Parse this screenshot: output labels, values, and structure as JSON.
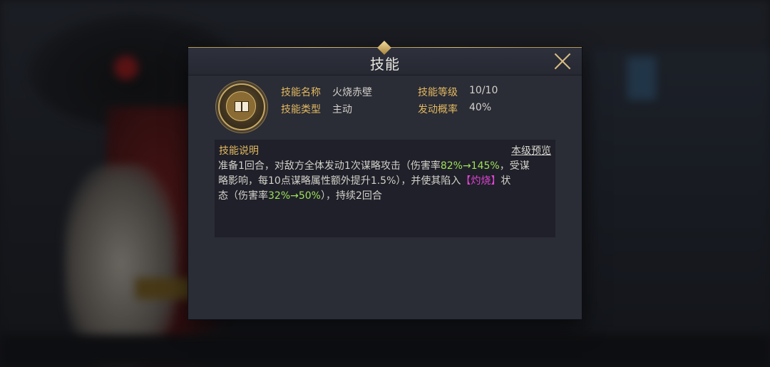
{
  "dialog": {
    "title": "技能",
    "close_icon": "close-icon",
    "skill_icon": "book-icon",
    "fields": {
      "name_label": "技能名称",
      "name_value": "火烧赤壁",
      "level_label": "技能等级",
      "level_value": "10/10",
      "type_label": "技能类型",
      "type_value": "主动",
      "chance_label": "发动概率",
      "chance_value": "40%"
    },
    "description": {
      "title": "技能说明",
      "preview_link": "本级预览",
      "line1_a": "准备1回合，对敌方全体发动1次谋略攻击（伤害率",
      "line1_green": "82%→145%",
      "line1_b": "，受谋",
      "line2_a": "略影响，每10点谋略属性额外提升1.5%），并使其陷入",
      "line2_pink": "【灼烧】",
      "line2_b": "状",
      "line3_a": "态（伤害率",
      "line3_green": "32%→50%",
      "line3_b": "），持续2回合"
    }
  },
  "colors": {
    "accent_gold": "#e3b960",
    "green_value": "#9fe15a",
    "status_pink": "#e044d4"
  }
}
